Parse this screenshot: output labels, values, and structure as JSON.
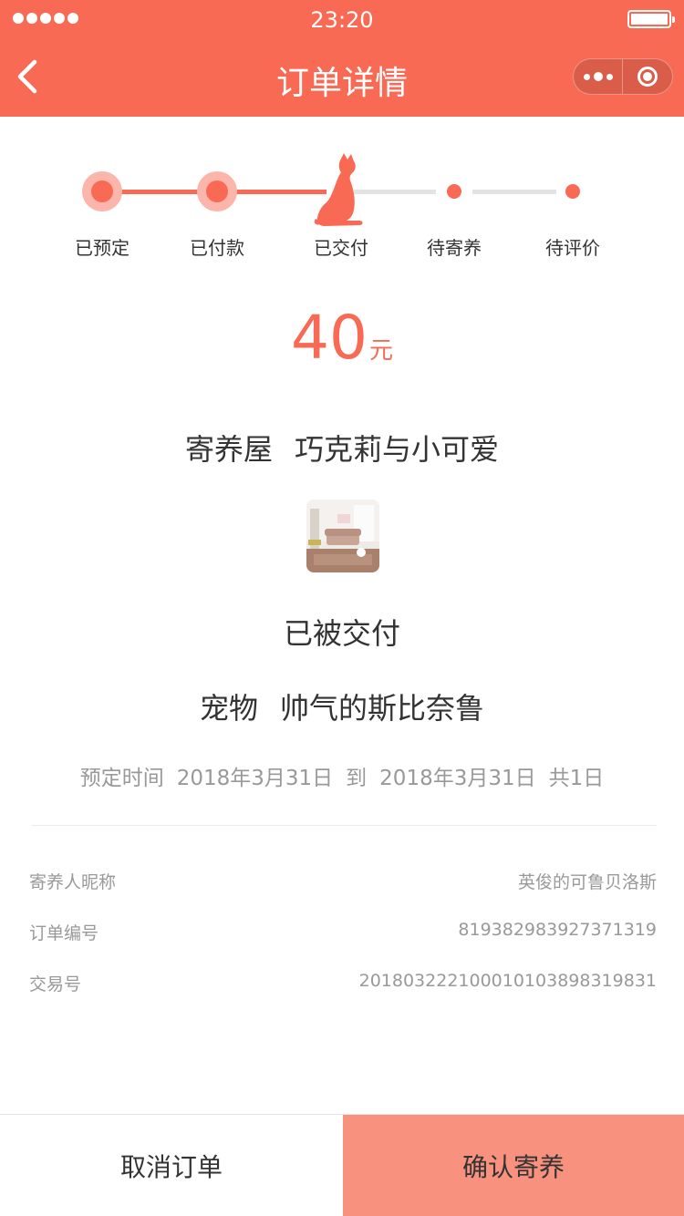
{
  "status_bar": {
    "time": "23:20"
  },
  "nav": {
    "title": "订单详情"
  },
  "steps": [
    {
      "label": "已预定",
      "state": "done"
    },
    {
      "label": "已付款",
      "state": "done"
    },
    {
      "label": "已交付",
      "state": "current"
    },
    {
      "label": "待寄养",
      "state": "todo"
    },
    {
      "label": "待评价",
      "state": "todo"
    }
  ],
  "price": {
    "amount": "40",
    "unit": "元"
  },
  "foster_home": {
    "label": "寄养屋",
    "name": "巧克莉与小可爱"
  },
  "order_status": "已被交付",
  "pet": {
    "label": "宠物",
    "name": "帅气的斯比奈鲁"
  },
  "booking": {
    "label": "预定时间",
    "start": "2018年3月31日",
    "to": "到",
    "end": "2018年3月31日",
    "total": "共1日"
  },
  "details": [
    {
      "key": "寄养人昵称",
      "value": "英俊的可鲁贝洛斯"
    },
    {
      "key": "订单编号",
      "value": "819382983927371319"
    },
    {
      "key": "交易号",
      "value": "2018032221000101038983198​31"
    }
  ],
  "actions": {
    "cancel": "取消订单",
    "confirm": "确认寄养"
  },
  "colors": {
    "accent": "#f86a54",
    "accent_light": "#fbb5aa",
    "confirm_bg": "#f8927f"
  }
}
